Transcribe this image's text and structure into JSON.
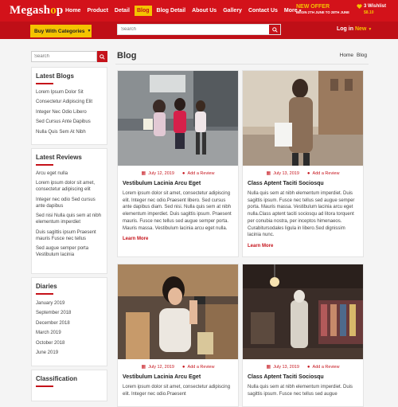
{
  "header": {
    "logo_main": "Megash",
    "logo_accent": "o",
    "logo_tail": "p",
    "nav": [
      {
        "label": "Home"
      },
      {
        "label": "Product"
      },
      {
        "label": "Detail"
      },
      {
        "label": "Blog"
      },
      {
        "label": "Blog Detail"
      },
      {
        "label": "About Us"
      },
      {
        "label": "Gallery"
      },
      {
        "label": "Contact Us"
      },
      {
        "label": "More"
      }
    ],
    "active_nav": "Blog",
    "offer_title": "NEW OFFER",
    "offer_sub": "BEGIN 2TH JUNE TO 28TH JUNE",
    "wishlist_label": "3 Wishlist",
    "wishlist_price": "$8.10",
    "category_button": "Buy With Categories",
    "search_placeholder": "Search",
    "login": "Log in",
    "new_badge": "New"
  },
  "sidebar": {
    "search_placeholder": "Search",
    "latest_blogs": {
      "title": "Latest Blogs",
      "items": [
        "Lorem Ipsum Dolor Sit",
        "Consectetur Adipiscing Elit",
        "Integer Nec Odio Libero",
        "Sed Cursus Ante Dapibus",
        "Nulla Quis Sem At Nibh"
      ]
    },
    "latest_reviews": {
      "title": "Latest Reviews",
      "items": [
        "Arcu eget nulla",
        "Lorem ipsum dolor sit amet, consectetur adipiscing elit",
        "Integer nec odio Sed cursus ante dapibus",
        "Sed nisi Nulla quis sem at nibh elementum imperdiet",
        "Duis sagittis ipsum Praesent mauris Fusce nec tellus",
        "Sed augue semper porta Vestibulum lacinia"
      ]
    },
    "diaries": {
      "title": "Diaries",
      "items": [
        "January 2019",
        "September 2018",
        "December 2018",
        "March 2019",
        "October 2018",
        "June 2019"
      ]
    },
    "classification": {
      "title": "Classification"
    }
  },
  "main": {
    "title": "Blog",
    "breadcrumb": [
      "Home",
      "Blog"
    ],
    "cards": [
      {
        "date": "July 12, 2019",
        "review": "Add a Review",
        "title": "Vestibulum Lacinia Arcu Eget",
        "text": "Lorem ipsum dolor sit amet, consectetur adipiscing elit. Integer nec odio.Praesent libero. Sed cursus ante dapibus diam. Sed nisi. Nulla quis sem at nibh elementum imperdiet. Duis sagittis ipsum. Praesent mauris. Fusce nec tellus sed augue semper porta. Mauris massa. Vestibulum lacinia arcu eget nulla.",
        "more": "Learn More"
      },
      {
        "date": "July 13, 2019",
        "review": "Add a Review",
        "title": "Class Aptent Taciti Sociosqu",
        "text": "Nulla quis sem at nibh elementum imperdiet. Duis sagittis ipsum. Fusce nec tellus sed augue semper porta. Mauris massa. Vestibulum lacinia arcu eget nulla.Class aptent taciti sociosqu ad litora torquent per conubia nostra, per inceptos himenaeos. Curabitursodales ligula in libero.Sed dignissim lacinia nunc.",
        "more": "Learn More"
      },
      {
        "date": "July 12, 2019",
        "review": "Add a Review",
        "title": "Vestibulum Lacinia Arcu Eget",
        "text": "Lorem ipsum dolor sit amet, consectetur adipiscing elit. Integer nec odio.Praesent",
        "more": ""
      },
      {
        "date": "July 13, 2019",
        "review": "Add a Review",
        "title": "Class Aptent Taciti Sociosqu",
        "text": "Nulla quis sem at nibh elementum imperdiet. Duis sagittis ipsum. Fusce nec tellus sed augue",
        "more": ""
      }
    ]
  },
  "colors": {
    "primary_red": "#d3121a",
    "dark_red": "#bf0f17",
    "accent_yellow": "#f4c300"
  }
}
